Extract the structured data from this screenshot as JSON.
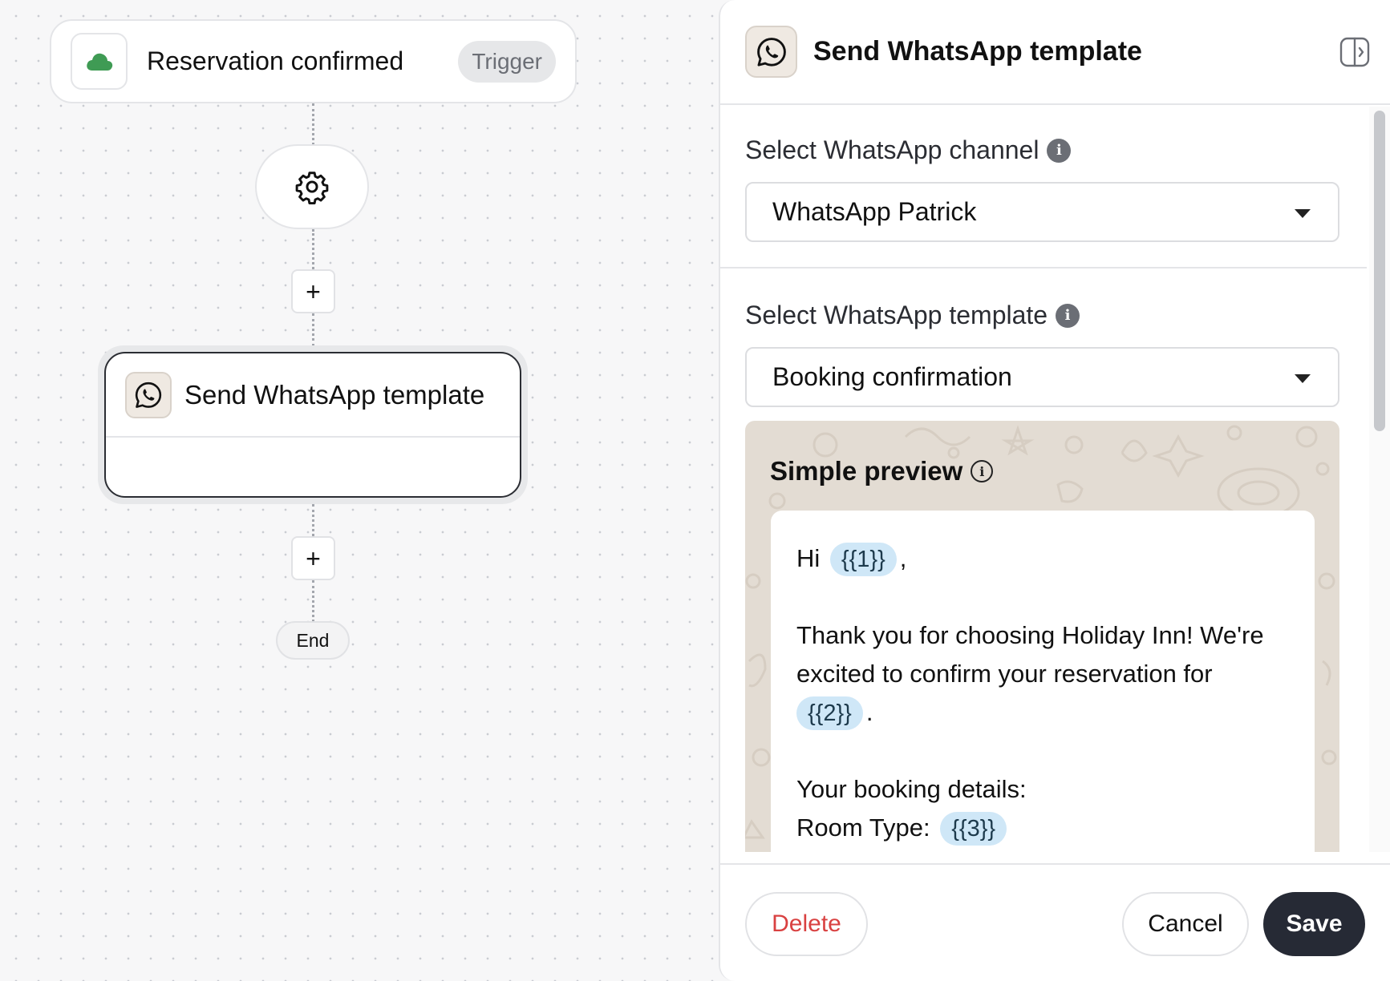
{
  "canvas": {
    "trigger": {
      "title": "Reservation confirmed",
      "badge": "Trigger",
      "icon": "cloud-icon",
      "icon_color": "#3f9b54"
    },
    "settings_icon": "gear-icon",
    "add_step_label": "+",
    "action": {
      "title": "Send WhatsApp template",
      "icon": "whatsapp-icon"
    },
    "end_label": "End"
  },
  "panel": {
    "title": "Send WhatsApp template",
    "header_icon": "whatsapp-icon",
    "collapse_icon": "collapse-panel-icon",
    "channel": {
      "label": "Select WhatsApp channel",
      "value": "WhatsApp Patrick",
      "info_icon": "i"
    },
    "template": {
      "label": "Select WhatsApp template",
      "value": "Booking confirmation",
      "info_icon": "i"
    },
    "preview": {
      "title": "Simple preview",
      "info_icon": "i",
      "greeting": "Hi",
      "var1": "{{1}}",
      "after_var1": ",",
      "line1": "Thank you for choosing Holiday Inn! We're",
      "line2": "excited to confirm your reservation for",
      "var2": "{{2}}",
      "after_var2": ".",
      "details_heading": "Your booking details:",
      "room_type_label": "Room Type:",
      "var3": "{{3}}"
    },
    "footer": {
      "delete": "Delete",
      "cancel": "Cancel",
      "save": "Save"
    }
  },
  "colors": {
    "accent_dark": "#262a35",
    "danger": "#d94141",
    "chip": "#cfe7f7",
    "preview_bg": "#e3dcd3"
  }
}
